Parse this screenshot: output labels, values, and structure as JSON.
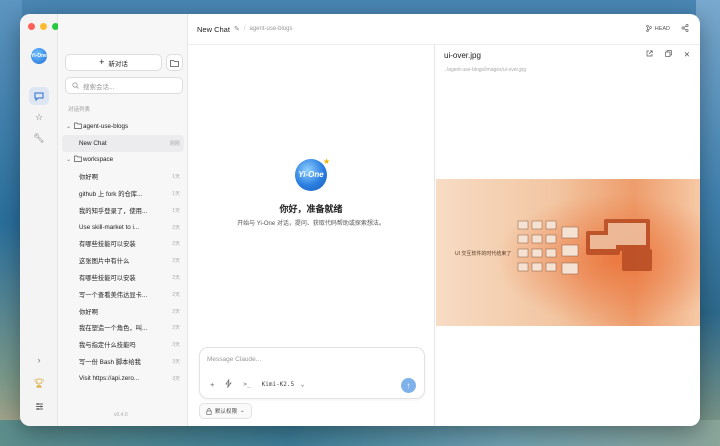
{
  "window": {
    "traffic_lights": [
      "#fe5f57",
      "#febc2e",
      "#28c840"
    ]
  },
  "rail": {
    "logo": "Yi-One",
    "items": [
      {
        "icon": "chat-bubble-icon",
        "active": true
      },
      {
        "icon": "star-icon",
        "active": false
      },
      {
        "icon": "wrench-icon",
        "active": false
      }
    ],
    "bottom": [
      "chevron-right-icon",
      "trophy-icon",
      "sliders-icon"
    ]
  },
  "sidebar": {
    "new_chat_label": "新对话",
    "search_placeholder": "搜索会话...",
    "list_heading": "对话列表",
    "tree": [
      {
        "type": "folder",
        "label": "agent-use-blogs",
        "time": ""
      },
      {
        "type": "chat",
        "label": "New Chat",
        "time": "刚刚",
        "selected": true
      },
      {
        "type": "folder",
        "label": "workspace",
        "time": ""
      },
      {
        "type": "chat",
        "label": "你好啊",
        "time": "1天"
      },
      {
        "type": "chat",
        "label": "github 上 fork 的仓库...",
        "time": "1天"
      },
      {
        "type": "chat",
        "label": "我的知乎登录了，使用...",
        "time": "1天"
      },
      {
        "type": "chat",
        "label": "Use skill-market to i...",
        "time": "2天"
      },
      {
        "type": "chat",
        "label": "有哪些技能可以安装",
        "time": "2天"
      },
      {
        "type": "chat",
        "label": "这张图片中有什么",
        "time": "2天"
      },
      {
        "type": "chat",
        "label": "有哪些技能可以安装",
        "time": "2天"
      },
      {
        "type": "chat",
        "label": "写一个查看美伟达显卡...",
        "time": "2天"
      },
      {
        "type": "chat",
        "label": "你好啊",
        "time": "2天"
      },
      {
        "type": "chat",
        "label": "我在塑造一个角色，叫...",
        "time": "2天"
      },
      {
        "type": "chat",
        "label": "我与指定什么技能吗",
        "time": "3天"
      },
      {
        "type": "chat",
        "label": "写一份 Bash 脚本给我",
        "time": "3天"
      },
      {
        "type": "chat",
        "label": "Visit https://api.zero...",
        "time": "3天"
      }
    ],
    "version": "v0.4.0"
  },
  "header": {
    "title": "New Chat",
    "breadcrumb": "agent-use-blogs",
    "branch": "HEAD"
  },
  "chat": {
    "logo_text": "Yi-One",
    "greeting": "你好，准备就绪",
    "subtitle": "开始与 Yi-One 对话，提问、获取代码帮助或探索想法。",
    "composer_placeholder": "Message Claude...",
    "model": "Kimi-K2.5",
    "permission_label": "默认权限"
  },
  "preview": {
    "filename": "ui-over.jpg",
    "path": "../agent-use-blogs/images/ui-over.jpg",
    "image_caption": "UI 交互软件的时代结束了"
  }
}
